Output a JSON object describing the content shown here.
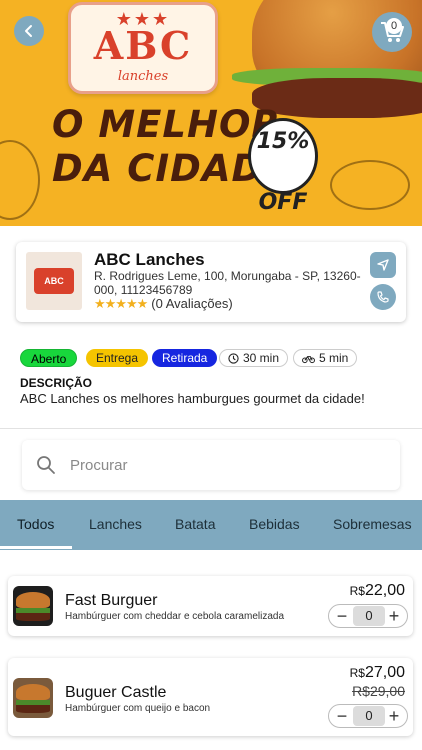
{
  "banner": {
    "logo_main": "ABC",
    "logo_sub": "lanches",
    "headline_line1": "O MELHOR",
    "headline_line2": "DA CIDADE",
    "promo_percent": "15%",
    "promo_label": "OFF"
  },
  "header": {
    "cart_count": "0"
  },
  "store": {
    "name": "ABC Lanches",
    "address": "R. Rodrigues Leme, 100, Morungaba - SP, 13260-000, 11123456789",
    "rating_stars": "★★★★★",
    "rating_text": "(0 Avaliações)",
    "logo_text": "ABC"
  },
  "badges": {
    "open": "Aberto",
    "delivery": "Entrega",
    "pickup": "Retirada",
    "prep_time": "30 min",
    "delivery_time": "5 min"
  },
  "description": {
    "title": "DESCRIÇÃO",
    "text": "ABC Lanches os melhores hamburgues gourmet da cidade!"
  },
  "search": {
    "placeholder": "Procurar"
  },
  "tabs": [
    "Todos",
    "Lanches",
    "Batata",
    "Bebidas",
    "Sobremesas"
  ],
  "products": [
    {
      "name": "Fast Burguer",
      "description": "Hambúrguer com cheddar e cebola caramelizada",
      "currency": "R$",
      "price": "22,00",
      "old_price": "",
      "quantity": "0"
    },
    {
      "name": "Buguer Castle",
      "description": "Hambúrguer com queijo e bacon",
      "currency": "R$",
      "price": "27,00",
      "old_price": "R$29,00",
      "quantity": "0"
    }
  ],
  "colors": {
    "accent": "#7fa9bf",
    "banner": "#f5b223",
    "open": "#18d73c",
    "delivery": "#f5c400",
    "pickup": "#1626e0"
  }
}
